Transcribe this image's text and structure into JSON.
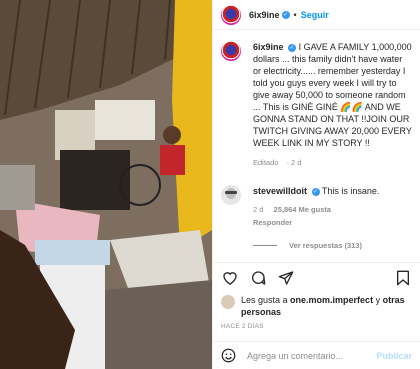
{
  "post": {
    "username": "6ix9ine",
    "follow_label": "Seguir",
    "caption": "I GAVE A FAMILY 1,000,000 dollars ... this family didn't have water or electricity...... remember yesterday I told you guys every week I will try to give away 50,000 to someone random ... This is GINÈ GINÈ 🌈🌈 AND WE GONNA STAND ON THAT !!JOIN OUR TWITCH GIVING AWAY 20,000 EVERY WEEK LINK IN MY STORY !!",
    "edited_label": "Editado",
    "caption_age": "2 d"
  },
  "comment": {
    "username": "stevewilldoit",
    "text": "This is insane.",
    "age": "2 d",
    "likes": "25,864 Me gusta",
    "reply_label": "Responder",
    "view_replies": "Ver respuestas (313)"
  },
  "likes": {
    "prefix": "Les gusta a ",
    "user": "one.mom.imperfect",
    "middle": " y ",
    "others": "otras personas"
  },
  "date_label": "HACE 2 DÍAS",
  "composer": {
    "placeholder": "Agrega un comentario...",
    "publish_label": "Publicar"
  },
  "icons": {
    "like": "heart-icon",
    "comment": "comment-icon",
    "share": "send-icon",
    "save": "bookmark-icon",
    "emoji": "smiley-icon"
  },
  "colors": {
    "link_blue": "#0095f6",
    "muted": "#8e8e8e",
    "verified": "#3897f0"
  }
}
